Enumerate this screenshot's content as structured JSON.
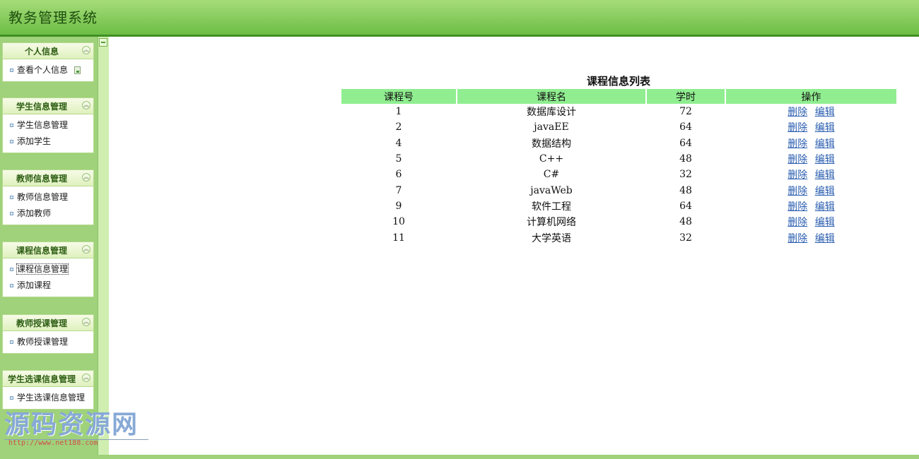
{
  "app": {
    "title": "教务管理系统"
  },
  "sidebar": {
    "groups": [
      {
        "title": "个人信息",
        "items": [
          {
            "label": "查看个人信息"
          }
        ]
      },
      {
        "title": "学生信息管理",
        "items": [
          {
            "label": "学生信息管理"
          },
          {
            "label": "添加学生"
          }
        ]
      },
      {
        "title": "教师信息管理",
        "items": [
          {
            "label": "教师信息管理"
          },
          {
            "label": "添加教师"
          }
        ]
      },
      {
        "title": "课程信息管理",
        "items": [
          {
            "label": "课程信息管理",
            "selected": true
          },
          {
            "label": "添加课程"
          }
        ]
      },
      {
        "title": "教师授课管理",
        "items": [
          {
            "label": "教师授课管理"
          }
        ]
      },
      {
        "title": "学生选课信息管理",
        "items": [
          {
            "label": "学生选课信息管理"
          }
        ]
      }
    ]
  },
  "course_table": {
    "caption": "课程信息列表",
    "headers": {
      "id": "课程号",
      "name": "课程名",
      "hours": "学时",
      "ops": "操作"
    },
    "delete_label": "删除",
    "edit_label": "编辑",
    "rows": [
      {
        "id": "1",
        "name": "数据库设计",
        "hours": "72"
      },
      {
        "id": "2",
        "name": "javaEE",
        "hours": "64"
      },
      {
        "id": "4",
        "name": "数据结构",
        "hours": "64"
      },
      {
        "id": "5",
        "name": "C++",
        "hours": "48"
      },
      {
        "id": "6",
        "name": "C#",
        "hours": "32"
      },
      {
        "id": "7",
        "name": "javaWeb",
        "hours": "48"
      },
      {
        "id": "9",
        "name": "软件工程",
        "hours": "64"
      },
      {
        "id": "10",
        "name": "计算机网络",
        "hours": "48"
      },
      {
        "id": "11",
        "name": "大学英语",
        "hours": "32"
      }
    ]
  },
  "watermark": {
    "text": "源码资源网",
    "url": "http://www.net188.com"
  },
  "colors": {
    "header_green": "#6cbd45",
    "table_header": "#90ee90",
    "link_blue": "#2a5db0"
  }
}
